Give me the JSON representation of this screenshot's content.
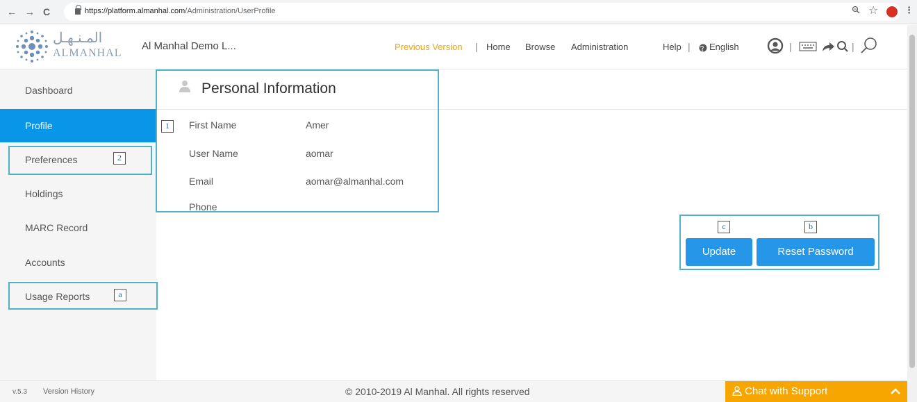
{
  "browser": {
    "back": "←",
    "forward": "→",
    "reload": "C",
    "url_host": "https://platform.almanhal.com",
    "url_path": "/Administration/UserProfile",
    "zoom_icon": "zoom-icon",
    "star_icon": "star-icon"
  },
  "header": {
    "logo_ar": "المـنـهـل",
    "logo_en": "ALMANHAL",
    "institution": "Al Manhal Demo L...",
    "nav": {
      "previous_version": "Previous Version",
      "home": "Home",
      "browse": "Browse",
      "administration": "Administration",
      "help": "Help",
      "english": "English"
    },
    "separator": "|"
  },
  "sidebar": {
    "items": [
      {
        "label": "Dashboard"
      },
      {
        "label": "Profile"
      },
      {
        "label": "Preferences"
      },
      {
        "label": "Holdings"
      },
      {
        "label": "MARC Record"
      },
      {
        "label": "Accounts"
      },
      {
        "label": "Usage Reports"
      }
    ],
    "active": "Profile"
  },
  "tags": {
    "one": "1",
    "two": "2",
    "a": "a",
    "b": "b",
    "c": "c"
  },
  "personal_info": {
    "title": "Personal Information",
    "fields": [
      {
        "label": "First Name",
        "value": "Amer"
      },
      {
        "label": "User Name",
        "value": "aomar"
      },
      {
        "label": "Email",
        "value": "aomar@almanhal.com"
      },
      {
        "label": "Phone",
        "value": ""
      }
    ]
  },
  "actions": {
    "update": "Update",
    "reset_password": "Reset Password"
  },
  "footer": {
    "version": "v.5.3",
    "version_history": "Version History",
    "copyright": "© 2010-2019 Al Manhal. All rights reserved",
    "chat": "Chat with Support"
  },
  "colors": {
    "accent": "#0a96e8",
    "button": "#2596e8",
    "highlight_box": "#4fb2c6",
    "chat": "#f7a600",
    "previous_version": "#f0a500"
  }
}
